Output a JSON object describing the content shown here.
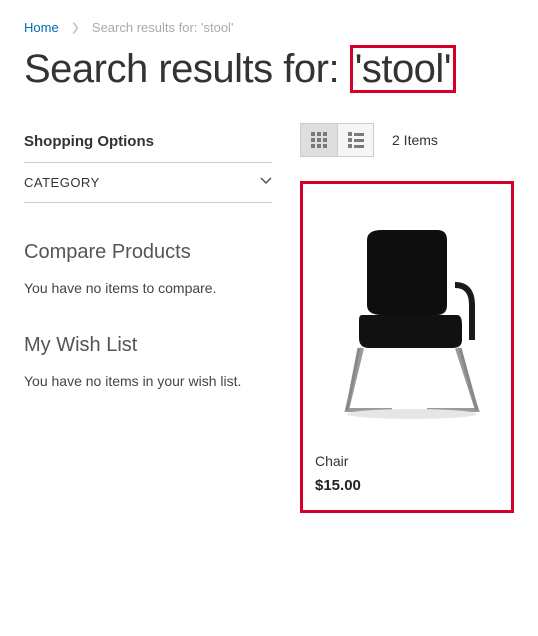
{
  "breadcrumb": {
    "home": "Home",
    "current": "Search results for: 'stool'"
  },
  "page_title": {
    "prefix": "Search results for: ",
    "highlighted": "'stool'"
  },
  "sidebar": {
    "shopping_options_title": "Shopping Options",
    "filters": [
      {
        "label": "CATEGORY"
      }
    ],
    "compare": {
      "title": "Compare Products",
      "empty": "You have no items to compare."
    },
    "wishlist": {
      "title": "My Wish List",
      "empty": "You have no items in your wish list."
    }
  },
  "toolbar": {
    "count": "2 Items"
  },
  "product": {
    "name": "Chair",
    "price": "$15.00"
  }
}
